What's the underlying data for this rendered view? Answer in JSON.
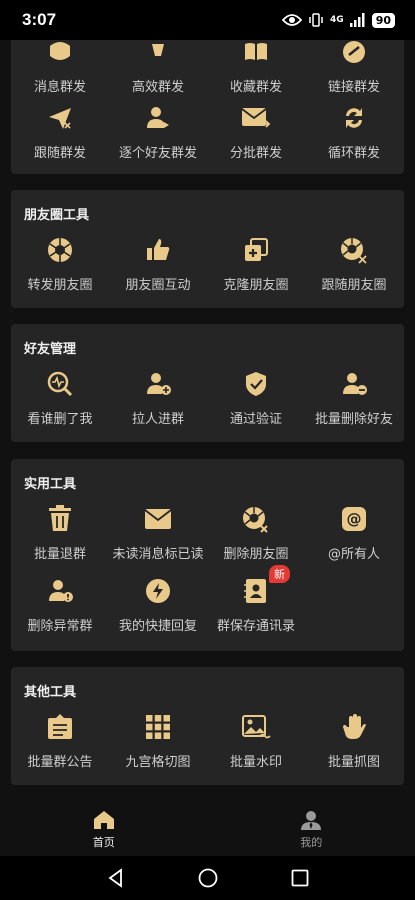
{
  "status": {
    "time": "3:07",
    "network": "4G",
    "battery": "90"
  },
  "accent": "#e8c98a",
  "sections": {
    "mass": {
      "row1": [
        "消息群发",
        "高效群发",
        "收藏群发",
        "链接群发"
      ],
      "row2": [
        "跟随群发",
        "逐个好友群发",
        "分批群发",
        "循环群发"
      ]
    },
    "moments": {
      "title": "朋友圈工具",
      "items": [
        "转发朋友圈",
        "朋友圈互动",
        "克隆朋友圈",
        "跟随朋友圈"
      ]
    },
    "friends": {
      "title": "好友管理",
      "items": [
        "看谁删了我",
        "拉人进群",
        "通过验证",
        "批量删除好友"
      ]
    },
    "utility": {
      "title": "实用工具",
      "row1": [
        "批量退群",
        "未读消息标已读",
        "删除朋友圈",
        "@所有人"
      ],
      "row2": [
        "删除异常群",
        "我的快捷回复",
        "群保存通讯录"
      ],
      "badge": "新"
    },
    "other": {
      "title": "其他工具",
      "items": [
        "批量群公告",
        "九宫格切图",
        "批量水印",
        "批量抓图"
      ]
    }
  },
  "bottom_nav": {
    "home": "首页",
    "mine": "我的"
  }
}
